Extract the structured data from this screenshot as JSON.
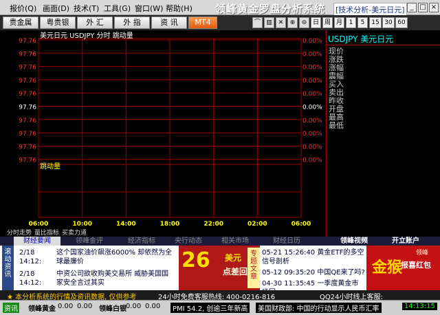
{
  "menu": [
    "报价(Q)",
    "画面(D)",
    "技术(T)",
    "工具(G)",
    "窗口(W)",
    "帮助(H)"
  ],
  "app_title": "领峰黄金罗盘分析系统",
  "tech_title": "[技术分析-美元日元]",
  "window_controls": [
    "_",
    "□",
    "×"
  ],
  "toolbar": {
    "tabs": [
      "贵金属",
      "粤贵银",
      "外 汇",
      "外 指",
      "资 讯",
      "MT4"
    ],
    "periods": [
      "日",
      "周",
      "月",
      "1",
      "5",
      "15",
      "30",
      "60"
    ]
  },
  "chart": {
    "header": "美元日元 USDJPY 分时 跳动量",
    "price_labels": [
      "97.76",
      "97.76",
      "97.76",
      "97.76",
      "97.76",
      "97.76",
      "97.76",
      "97.76",
      "97.76",
      "97.76"
    ],
    "pct_labels": [
      "0.00%",
      "0.00%",
      "0.00%",
      "0.00%",
      "0.00%",
      "0.00%",
      "0.00%",
      "0.00%",
      "0.00%",
      "0.00%"
    ],
    "volume_label": "跳动量",
    "time_labels": [
      "06:00",
      "10:00",
      "14:00",
      "18:00",
      "22:00",
      "02:00",
      "06:00"
    ],
    "bottom_tabs": [
      "分时走势",
      "量比指标",
      "买卖力道"
    ],
    "colors": {
      "grid": "#a00000",
      "price": "#ff3333",
      "pct": "#ff3333",
      "time": "#ffff00",
      "neutral": "#ffffff"
    }
  },
  "quote_panel": {
    "symbol": "USDJPY 美元日元",
    "fields": [
      "现价",
      "涨跌",
      "涨幅",
      "震幅",
      "买入",
      "卖出",
      "昨收",
      "开盘",
      "最高",
      "最低"
    ]
  },
  "news_tabs": [
    "财经要闻",
    "领峰金评",
    "经济指标",
    "央行动态",
    "相关市场",
    "财经日历",
    "领峰视频",
    "开立账户"
  ],
  "news_vertical_label": "滚动资讯",
  "news_left": [
    {
      "time": "2/18 14:12:",
      "text": "这个国家油价飙涨6000% 却依然为全球最廉价"
    },
    {
      "time": "2/18 14:12:",
      "text": "中资公司欲收购美交易所 威胁美国国家安全言过其实"
    }
  ],
  "news_right": [
    {
      "time": "05-21 15:26:40",
      "text": "黄金ETF的多空信号剖析"
    },
    {
      "time": "05-12 09:35:20",
      "text": "中国QE来了吗?"
    },
    {
      "time": "04-30 11:35:45",
      "text": "一季度黄金市场回"
    }
  ],
  "ad1": {
    "big": "26",
    "txt": "美元",
    "sub": "点差回",
    "btn": "专题文章"
  },
  "ad2": {
    "big": "金猴",
    "txt": "报喜红包",
    "top": "领峰"
  },
  "status": {
    "disclaimer": "★ 本分析系统的行情及资讯数据, 仅供参考",
    "hotline": "24小时免费客服热线: 400-0216-816",
    "qq": "QQ24小时线上客服:"
  },
  "bottom": {
    "item1_label": "资讯",
    "gold_label": "领峰黄金",
    "gold_val": "0.00",
    "gold_chg": "0.00",
    "silver_label": "领峰白银",
    "silver_val": "0.00",
    "silver_chg": "0.00",
    "ticker": "PMI 54.2, 创逾三年新高",
    "ticker2": "美国财政部: 中国的行动显示人民币汇率",
    "clock": "14:13:15"
  }
}
